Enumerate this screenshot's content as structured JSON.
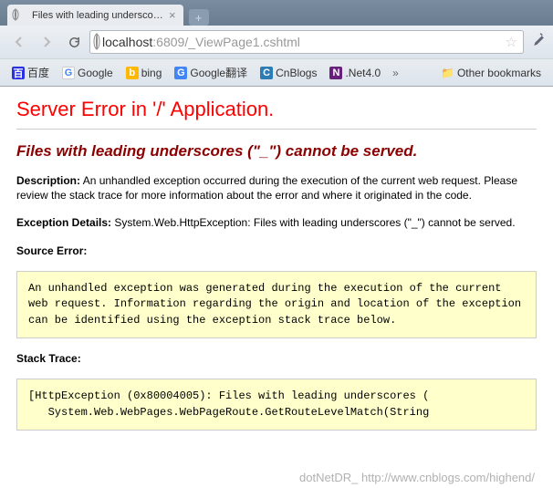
{
  "tab": {
    "title": "Files with leading underscores"
  },
  "url": {
    "host": "localhost",
    "port": ":6809",
    "path": "/_ViewPage1.cshtml"
  },
  "bookmarks": {
    "b0": "百度",
    "b1": "Google",
    "b2": "bing",
    "b3": "Google翻译",
    "b4": "CnBlogs",
    "b5": ".Net4.0",
    "other": "Other bookmarks"
  },
  "error": {
    "h1": "Server Error in '/' Application.",
    "h2": "Files with leading underscores (\"_\") cannot be served.",
    "desc_label": "Description:",
    "desc_text": " An unhandled exception occurred during the execution of the current web request. Please review the stack trace for more information about the error and where it originated in the code.",
    "exc_label": "Exception Details:",
    "exc_text": " System.Web.HttpException: Files with leading underscores (\"_\") cannot be served.",
    "src_label": "Source Error:",
    "src_box": "An unhandled exception was generated during the execution of the current web request. Information regarding the origin and location of the exception can be identified using the exception stack trace below.",
    "stack_label": "Stack Trace:",
    "stack_box": "[HttpException (0x80004005): Files with leading underscores (\n   System.Web.WebPages.WebPageRoute.GetRouteLevelMatch(String"
  },
  "watermark": "dotNetDR_ http://www.cnblogs.com/highend/"
}
